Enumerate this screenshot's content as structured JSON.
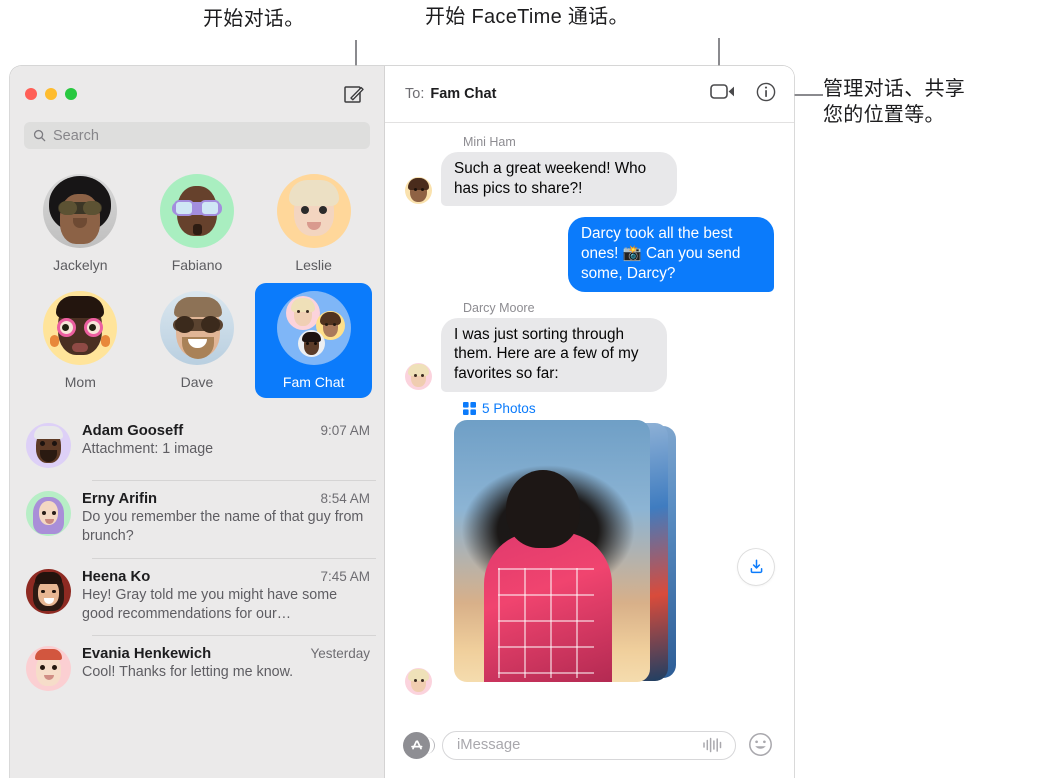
{
  "callouts": [
    {
      "id": "compose",
      "text": "开始对话。"
    },
    {
      "id": "facetime",
      "text": "开始 FaceTime 通话。"
    },
    {
      "id": "info",
      "text": "管理对话、共享\n您的位置等。"
    }
  ],
  "window": {
    "traffic_lights": [
      "close",
      "minimize",
      "zoom"
    ],
    "compose_icon": "compose-icon"
  },
  "sidebar": {
    "search": {
      "placeholder": "Search",
      "icon": "search-icon"
    },
    "pinned": [
      {
        "name": "Jackelyn",
        "selected": false
      },
      {
        "name": "Fabiano",
        "selected": false
      },
      {
        "name": "Leslie",
        "selected": false
      },
      {
        "name": "Mom",
        "selected": false
      },
      {
        "name": "Dave",
        "selected": false
      },
      {
        "name": "Fam Chat",
        "selected": true
      }
    ],
    "conversations": [
      {
        "name": "Adam Gooseff",
        "time": "9:07 AM",
        "preview": "Attachment: 1 image"
      },
      {
        "name": "Erny Arifin",
        "time": "8:54 AM",
        "preview": "Do you remember the name of that guy from brunch?"
      },
      {
        "name": "Heena Ko",
        "time": "7:45 AM",
        "preview": "Hey! Gray told me you might have some good recommendations for our…"
      },
      {
        "name": "Evania Henkewich",
        "time": "Yesterday",
        "preview": "Cool! Thanks for letting me know."
      }
    ]
  },
  "chat": {
    "to_label": "To:",
    "to_value": "Fam Chat",
    "facetime_icon": "video-camera-icon",
    "info_icon": "info-circle-icon",
    "messages": [
      {
        "sender": "Mini Ham",
        "direction": "in",
        "text": "Such a great weekend! Who has pics to share?!"
      },
      {
        "sender": "",
        "direction": "out",
        "text": "Darcy took all the best ones! 📸 Can you send some, Darcy?"
      },
      {
        "sender": "Darcy Moore",
        "direction": "in",
        "text": "I was just sorting through them. Here are a few of my favorites so far:"
      }
    ],
    "attachment": {
      "count_label": "5 Photos",
      "grid_icon": "photo-grid-icon",
      "download_icon": "download-icon"
    },
    "composer": {
      "appstore_icon": "app-store-icon",
      "placeholder": "iMessage",
      "audio_icon": "audio-waveform-icon",
      "emoji_icon": "smiley-face-icon"
    }
  },
  "colors": {
    "accent_blue": "#0b7bfb",
    "bubble_in": "#e8e8ea",
    "sidebar_bg": "#ebeaea",
    "light_red": "#ff5f57",
    "light_yellow": "#febc2e",
    "light_green": "#28c840"
  }
}
